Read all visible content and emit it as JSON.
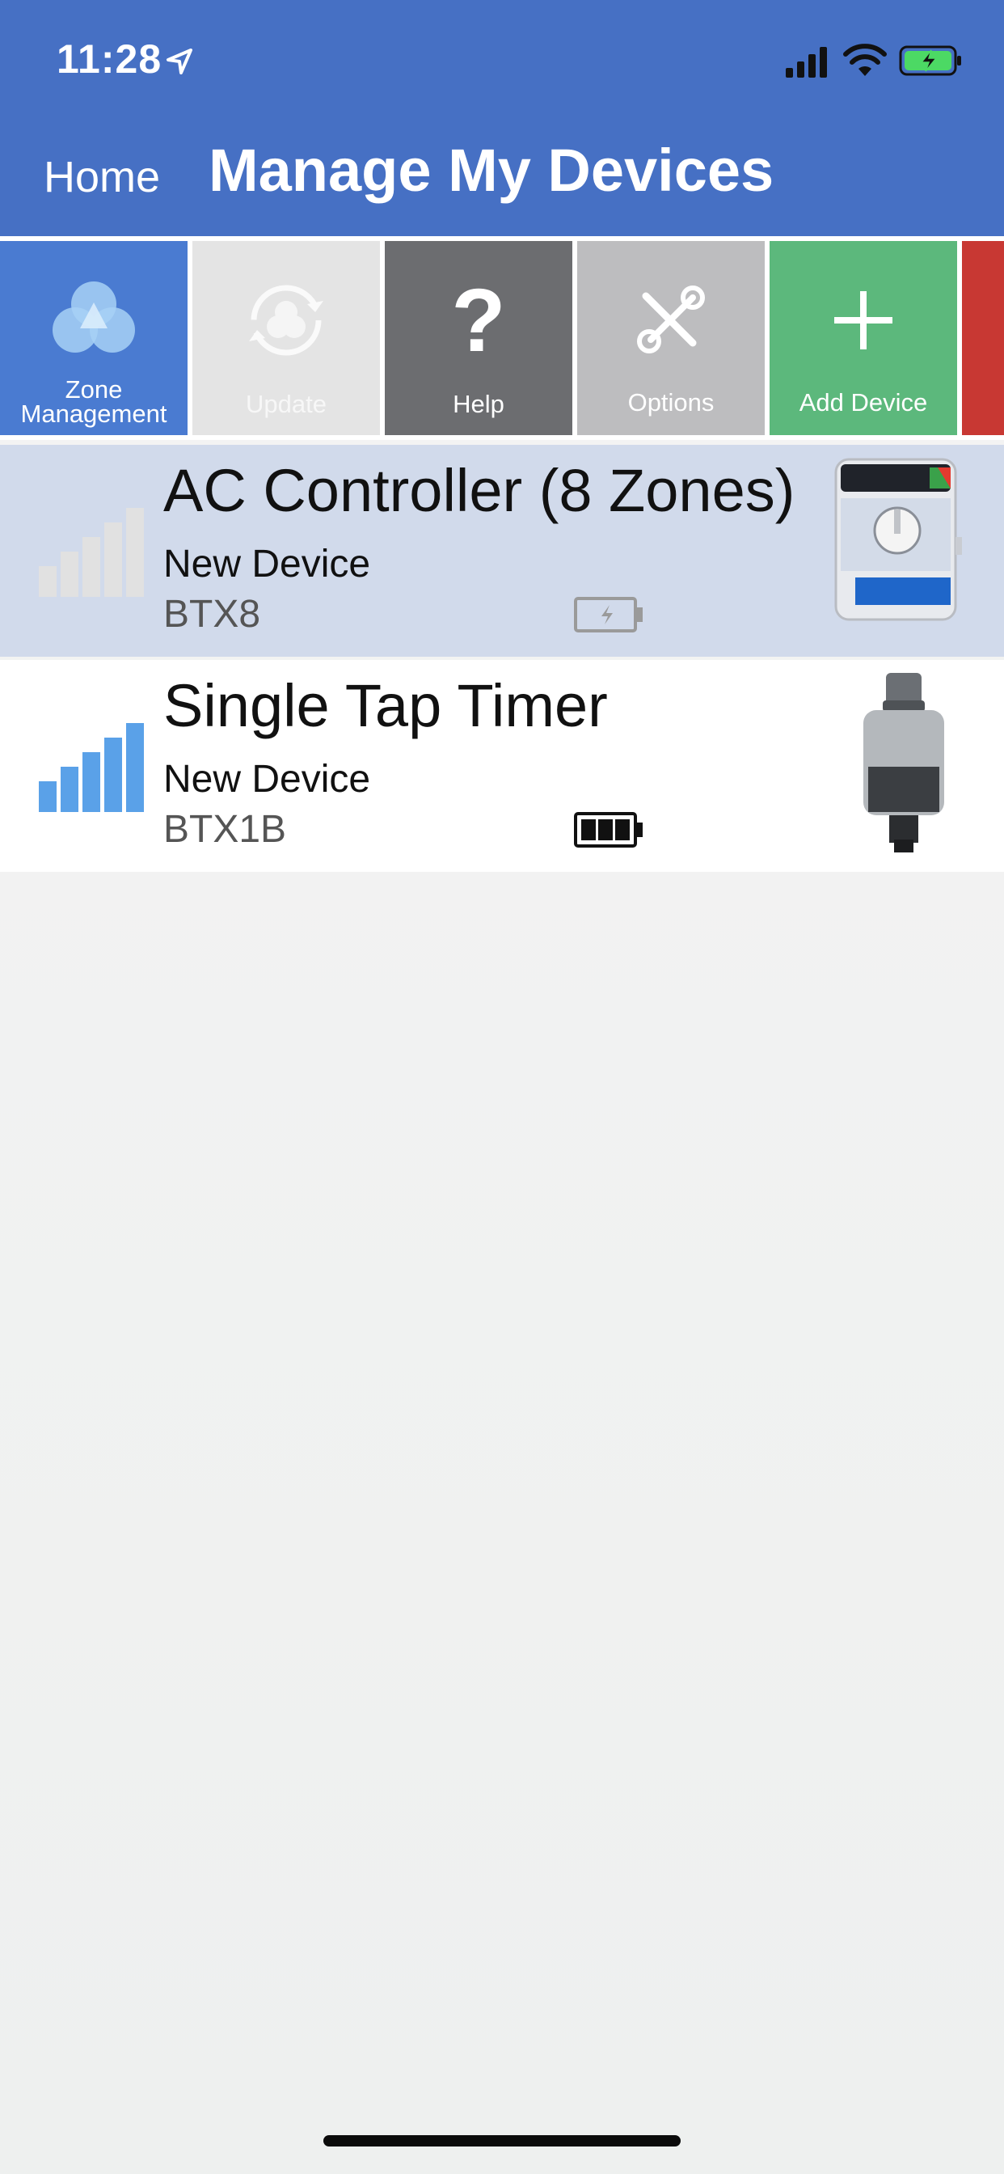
{
  "status_bar": {
    "time": "11:28"
  },
  "header": {
    "back_label": "Home",
    "title": "Manage My Devices"
  },
  "toolbar": {
    "zone_label_line1": "Zone",
    "zone_label_line2": "Management",
    "update_label": "Update",
    "help_label": "Help",
    "options_label": "Options",
    "add_label": "Add Device"
  },
  "devices": [
    {
      "name": "AC Controller (8 Zones)",
      "status": "New Device",
      "model": "BTX8",
      "signal_level": 0,
      "battery_state": "charging"
    },
    {
      "name": "Single Tap Timer",
      "status": "New Device",
      "model": "BTX1B",
      "signal_level": 4,
      "battery_state": "full"
    }
  ],
  "colors": {
    "header": "#4670c4",
    "zone_tile": "#4a7bd1",
    "help_tile": "#6c6d70",
    "options_tile": "#bdbdbf",
    "add_tile": "#5cb87c",
    "signal_active": "#5aa1e8",
    "selected_row": "#d1daeb"
  }
}
